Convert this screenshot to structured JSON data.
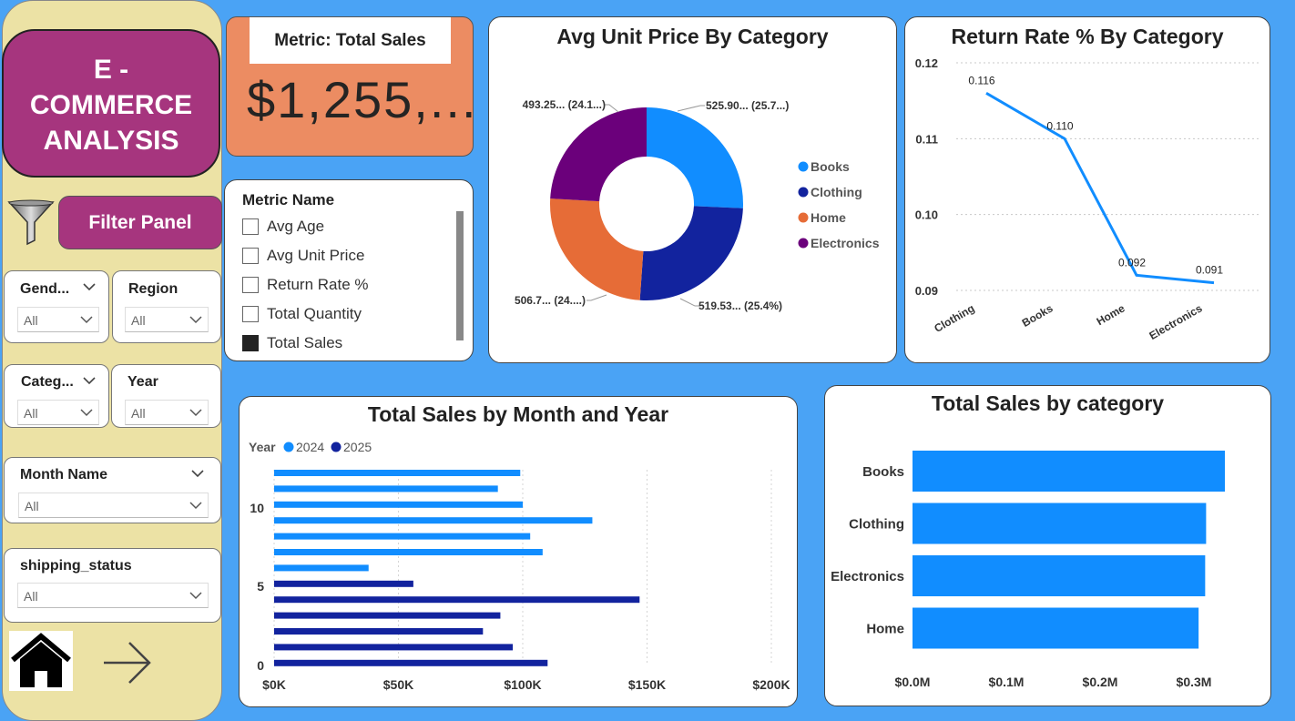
{
  "sidebar": {
    "title": "E - COMMERCE ANALYSIS",
    "filter_panel_label": "Filter Panel",
    "slicers": [
      {
        "label": "Gend...",
        "value": "All"
      },
      {
        "label": "Region",
        "value": "All"
      },
      {
        "label": "Categ...",
        "value": "All"
      },
      {
        "label": "Year",
        "value": "All"
      },
      {
        "label": "Month Name",
        "value": "All"
      },
      {
        "label": "shipping_status",
        "value": "All"
      }
    ]
  },
  "kpi": {
    "label": "Metric: Total Sales",
    "value": "$1,255,..."
  },
  "metric_list": {
    "header": "Metric Name",
    "items": [
      {
        "label": "Avg Age",
        "checked": false
      },
      {
        "label": "Avg Unit Price",
        "checked": false
      },
      {
        "label": "Return Rate %",
        "checked": false
      },
      {
        "label": "Total Quantity",
        "checked": false
      },
      {
        "label": "Total Sales",
        "checked": true
      }
    ]
  },
  "colors": {
    "books": "#118dff",
    "clothing": "#12239e",
    "home": "#e66c37",
    "electronics": "#6b007b",
    "title_box": "#a6357e",
    "kpi_bg": "#ec8c62",
    "background": "#4aa3f5"
  },
  "chart_data": [
    {
      "type": "pie",
      "title": "Avg Unit Price By Category",
      "slices": [
        {
          "name": "Books",
          "value": 525.9,
          "label": "525.90... (25.7...)",
          "color": "#118dff"
        },
        {
          "name": "Clothing",
          "value": 519.53,
          "label": "519.53... (25.4%)",
          "color": "#12239e"
        },
        {
          "name": "Home",
          "value": 506.7,
          "label": "506.7... (24....)",
          "color": "#e66c37"
        },
        {
          "name": "Electronics",
          "value": 493.25,
          "label": "493.25... (24.1...)",
          "color": "#6b007b"
        }
      ],
      "legend": [
        "Books",
        "Clothing",
        "Home",
        "Electronics"
      ],
      "legend_position": "right",
      "donut": true
    },
    {
      "type": "line",
      "title": "Return Rate % By Category",
      "categories": [
        "Clothing",
        "Books",
        "Home",
        "Electronics"
      ],
      "values": [
        0.116,
        0.11,
        0.092,
        0.091
      ],
      "data_labels": [
        "0.116",
        "0.110",
        "0.092",
        "0.091"
      ],
      "yticks": [
        "0.12",
        "0.11",
        "0.10",
        "0.09"
      ],
      "ylim": [
        0.09,
        0.12
      ],
      "grid": true
    },
    {
      "type": "bar",
      "orientation": "horizontal",
      "title": "Total Sales by Month and Year",
      "legend_title": "Year",
      "legend": [
        {
          "name": "2024",
          "color": "#118dff"
        },
        {
          "name": "2025",
          "color": "#12239e"
        }
      ],
      "bars_top_to_bottom": [
        {
          "series": "2024",
          "value": 99000
        },
        {
          "series": "2024",
          "value": 90000
        },
        {
          "series": "2024",
          "value": 100000
        },
        {
          "series": "2024",
          "value": 128000
        },
        {
          "series": "2024",
          "value": 103000
        },
        {
          "series": "2024",
          "value": 108000
        },
        {
          "series": "2024",
          "value": 38000
        },
        {
          "series": "2025",
          "value": 56000
        },
        {
          "series": "2025",
          "value": 147000
        },
        {
          "series": "2025",
          "value": 91000
        },
        {
          "series": "2025",
          "value": 84000
        },
        {
          "series": "2025",
          "value": 96000
        },
        {
          "series": "2025",
          "value": 110000
        }
      ],
      "xticks": [
        "$0K",
        "$50K",
        "$100K",
        "$150K",
        "$200K"
      ],
      "yticks": [
        "10",
        "5",
        "0"
      ],
      "xlim": [
        0,
        200000
      ],
      "grid": true
    },
    {
      "type": "bar",
      "orientation": "horizontal",
      "title": "Total Sales by category",
      "categories": [
        "Books",
        "Clothing",
        "Electronics",
        "Home"
      ],
      "values": [
        0.333,
        0.313,
        0.312,
        0.305
      ],
      "xticks": [
        "$0.0M",
        "$0.1M",
        "$0.2M",
        "$0.3M"
      ],
      "xlim": [
        0,
        0.36
      ],
      "color": "#118dff"
    }
  ]
}
